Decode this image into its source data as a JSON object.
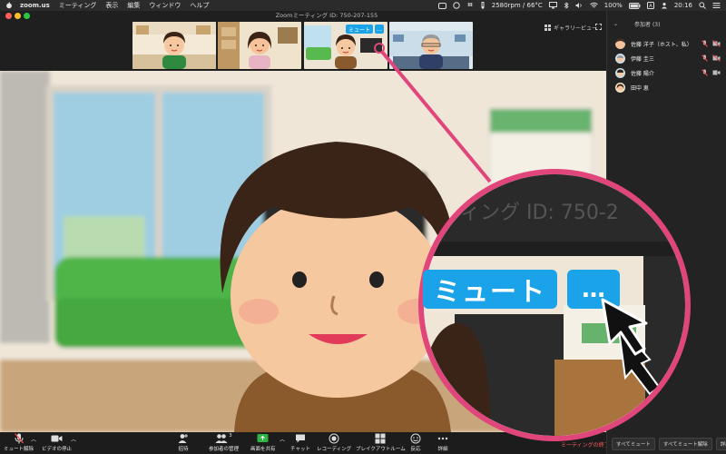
{
  "menubar": {
    "app_name": "zoom.us",
    "items": [
      "ミーティング",
      "表示",
      "編集",
      "ウィンドウ",
      "ヘルプ"
    ],
    "status_text": "2580rpm / 66°C",
    "battery": "100%",
    "clock": "20:16"
  },
  "window": {
    "title": "Zoomミーティング ID: 750-207-155"
  },
  "thumbnails": {
    "gallery_label": "ギャラリービュー",
    "mute_label": "ミュート",
    "more_label": "…"
  },
  "toolbar": {
    "unmute": "ミュート解除",
    "stop_video": "ビデオの停止",
    "invite": "招待",
    "manage_participants": "参加者の管理",
    "participant_count": "3",
    "share_screen": "画面を共有",
    "chat": "チャット",
    "record": "レコーディング",
    "breakout": "ブレイクアウトルーム",
    "reactions": "反応",
    "more": "詳細",
    "end_meeting": "ミーティングの終了"
  },
  "panel": {
    "header": "参加者 (3)",
    "participants": [
      {
        "name": "佐藤 洋子（ホスト、私）"
      },
      {
        "name": "伊藤 圭三"
      },
      {
        "name": "佐藤 陽介"
      },
      {
        "name": "田中 恵"
      }
    ],
    "mute_all": "すべてミュート",
    "unmute_all": "すべてミュート解除",
    "details": "詳細"
  },
  "callout": {
    "title_text": "ィング ID: 750-2",
    "mute_label": "ミュート",
    "more_label": "…"
  },
  "colors": {
    "accent_blue": "#1aa3e8",
    "callout_pink": "#e0457b",
    "end_red": "#ff5a5a"
  }
}
